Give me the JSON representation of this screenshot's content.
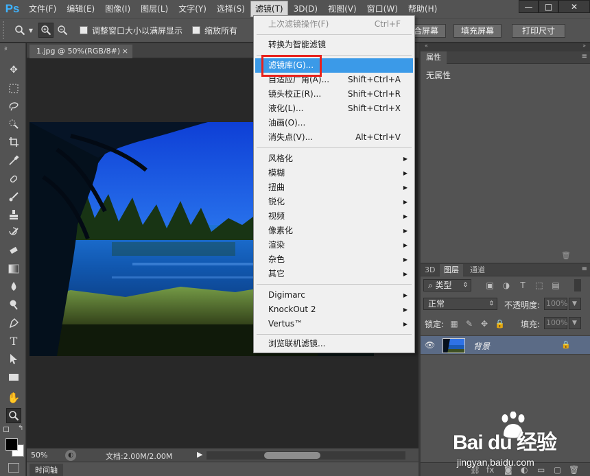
{
  "app": {
    "logo": "Ps",
    "window_buttons": {
      "minimize": "—",
      "maximize": "□",
      "close": "✕"
    }
  },
  "menubar": {
    "items": [
      {
        "label": "文件(F)"
      },
      {
        "label": "编辑(E)"
      },
      {
        "label": "图像(I)"
      },
      {
        "label": "图层(L)"
      },
      {
        "label": "文字(Y)"
      },
      {
        "label": "选择(S)"
      },
      {
        "label": "滤镜(T)"
      },
      {
        "label": "3D(D)"
      },
      {
        "label": "视图(V)"
      },
      {
        "label": "窗口(W)"
      },
      {
        "label": "帮助(H)"
      }
    ],
    "active_label": "滤镜(T)"
  },
  "options_bar": {
    "resize_window_label": "调整窗口大小以满屏显示",
    "zoom_all_label": "缩放所有",
    "fit_screen_button": "合屏幕",
    "fill_screen_button": "填充屏幕",
    "print_size_button": "打印尺寸"
  },
  "document": {
    "tab_title": "1.jpg @ 50%(RGB/8#)",
    "tab_close": "×",
    "zoom": "50%",
    "doc_size": "文档:2.00M/2.00M",
    "timeline_tab": "时间轴"
  },
  "filter_menu": {
    "items": [
      {
        "label": "上次滤镜操作(F)",
        "shortcut": "Ctrl+F",
        "disabled": true
      },
      {
        "label": "转换为智能滤镜"
      },
      {
        "label": "滤镜库(G)...",
        "highlighted": true
      },
      {
        "label": "自适应广角(A)...",
        "shortcut": "Shift+Ctrl+A"
      },
      {
        "label": "镜头校正(R)...",
        "shortcut": "Shift+Ctrl+R"
      },
      {
        "label": "液化(L)...",
        "shortcut": "Shift+Ctrl+X"
      },
      {
        "label": "油画(O)..."
      },
      {
        "label": "消失点(V)...",
        "shortcut": "Alt+Ctrl+V"
      },
      {
        "label": "风格化",
        "submenu": true
      },
      {
        "label": "模糊",
        "submenu": true
      },
      {
        "label": "扭曲",
        "submenu": true
      },
      {
        "label": "锐化",
        "submenu": true
      },
      {
        "label": "视频",
        "submenu": true
      },
      {
        "label": "像素化",
        "submenu": true
      },
      {
        "label": "渲染",
        "submenu": true
      },
      {
        "label": "杂色",
        "submenu": true
      },
      {
        "label": "其它",
        "submenu": true
      },
      {
        "label": "Digimarc",
        "submenu": true
      },
      {
        "label": "KnockOut 2",
        "submenu": true
      },
      {
        "label": "Vertus™",
        "submenu": true
      },
      {
        "label": "浏览联机滤镜..."
      }
    ]
  },
  "properties_panel": {
    "tab": "属性",
    "content": "无属性"
  },
  "layers_panel": {
    "tabs": [
      "3D",
      "图层",
      "通道"
    ],
    "active_tab": "图层",
    "filter_kind": "类型",
    "blend_mode": "正常",
    "opacity_label": "不透明度:",
    "opacity_value": "100%",
    "lock_label": "锁定:",
    "fill_label": "填充:",
    "fill_value": "100%",
    "layers": [
      {
        "name": "背景",
        "visible": true,
        "locked": true
      }
    ]
  },
  "watermark": {
    "brand": "Bai du 经验",
    "url": "jingyan.baidu.com"
  },
  "colors": {
    "accent_highlight": "#3b9ae8",
    "callout_red": "#e8221c",
    "ps_blue": "#3fb3ff"
  }
}
